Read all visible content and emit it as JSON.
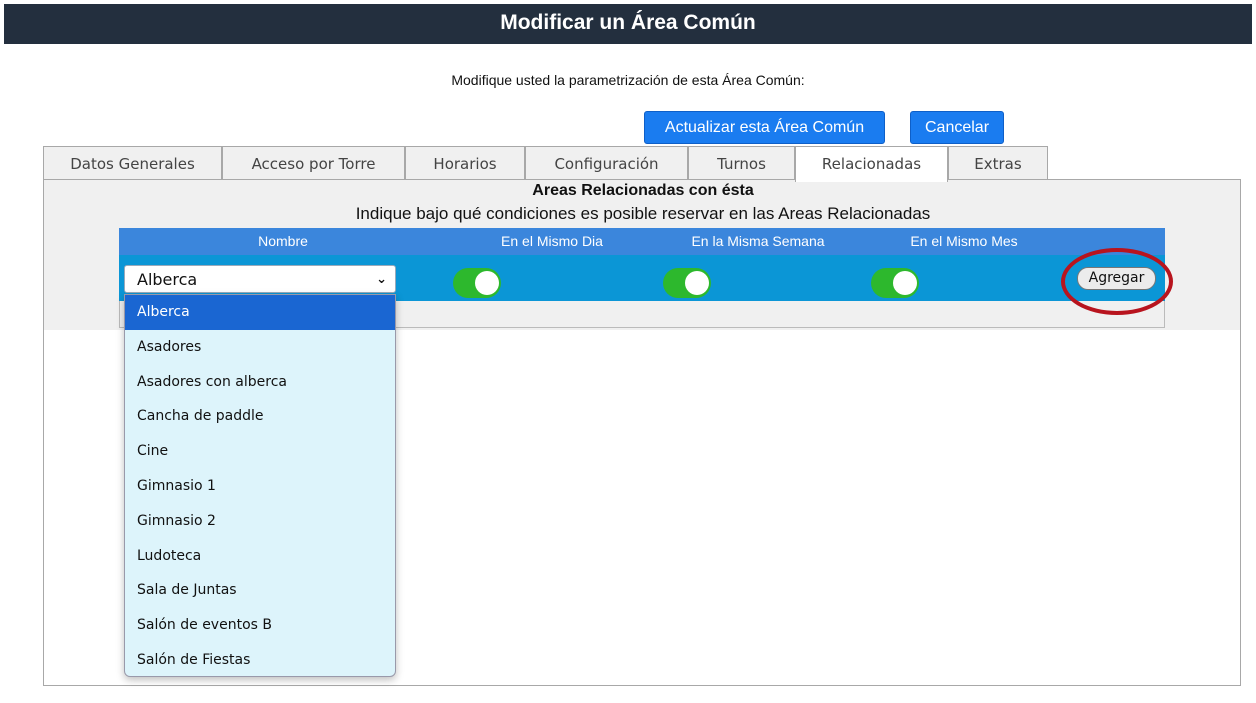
{
  "header": {
    "title": "Modificar un Área Común"
  },
  "subtitle": "Modifique usted la parametrización de esta Área Común:",
  "actions": {
    "update_label": "Actualizar esta Área Común",
    "cancel_label": "Cancelar"
  },
  "tabs": [
    {
      "label": "Datos Generales"
    },
    {
      "label": "Acceso por Torre"
    },
    {
      "label": "Horarios"
    },
    {
      "label": "Configuración"
    },
    {
      "label": "Turnos"
    },
    {
      "label": "Relacionadas"
    },
    {
      "label": "Extras"
    }
  ],
  "active_tab": "Relacionadas",
  "panel": {
    "title": "Areas Relacionadas con ésta",
    "subtitle": "Indique bajo qué condiciones es posible reservar en las Areas Relacionadas"
  },
  "table": {
    "headers": {
      "nombre": "Nombre",
      "mismo_dia": "En el Mismo Dia",
      "misma_semana": "En la Misma Semana",
      "mismo_mes": "En el Mismo Mes"
    },
    "row": {
      "selected_area": "Alberca",
      "mismo_dia": true,
      "misma_semana": true,
      "mismo_mes": true,
      "add_label": "Agregar"
    }
  },
  "dropdown": {
    "options": [
      "Alberca",
      "Asadores",
      "Asadores con alberca",
      "Cancha de paddle",
      "Cine",
      "Gimnasio 1",
      "Gimnasio 2",
      "Ludoteca",
      "Sala de Juntas",
      "Salón de eventos B",
      "Salón de Fiestas"
    ],
    "highlighted": "Alberca"
  },
  "colors": {
    "header_bg": "#232f3e",
    "primary_button": "#1a7cf0",
    "table_header": "#3b86dc",
    "table_row": "#0b96d6",
    "toggle_on": "#2db82d",
    "highlight_circle": "#b8141e",
    "dropdown_bg": "#ddf4fb",
    "dropdown_selected": "#1a66d2"
  },
  "icons": {
    "select_chevron": "chevron-down-icon"
  }
}
